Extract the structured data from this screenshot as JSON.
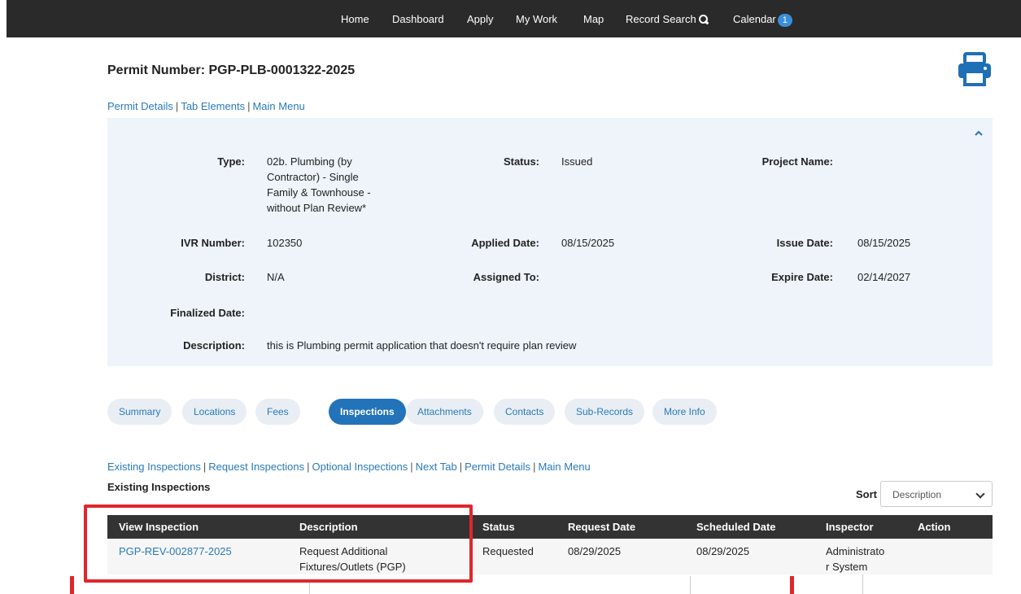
{
  "nav": {
    "items": [
      "Home",
      "Dashboard",
      "Apply",
      "My Work",
      "Map",
      "Record Search",
      "Calendar"
    ],
    "calendar_badge": "1"
  },
  "page": {
    "title": "Permit Number: PGP-PLB-0001322-2025",
    "breadcrumb": [
      "Permit Details",
      "Tab Elements",
      "Main Menu"
    ]
  },
  "details": {
    "type_label": "Type:",
    "type_value_lines": [
      "02b. Plumbing (by",
      "Contractor) - Single",
      "Family & Townhouse -",
      "without Plan Review*"
    ],
    "status_label": "Status:",
    "status_value": "Issued",
    "project_label": "Project Name:",
    "project_value": "",
    "ivr_label": "IVR Number:",
    "ivr_value": "102350",
    "applied_label": "Applied Date:",
    "applied_value": "08/15/2025",
    "issue_label": "Issue Date:",
    "issue_value": "08/15/2025",
    "district_label": "District:",
    "district_value": "N/A",
    "assigned_label": "Assigned To:",
    "assigned_value": "",
    "expire_label": "Expire Date:",
    "expire_value": "02/14/2027",
    "finalized_label": "Finalized Date:",
    "finalized_value": "",
    "description_label": "Description:",
    "description_value": "this is Plumbing permit application that doesn't require plan review"
  },
  "tabs": [
    "Summary",
    "Locations",
    "Fees",
    "Inspections",
    "Attachments",
    "Contacts",
    "Sub-Records",
    "More Info"
  ],
  "active_tab": "Inspections",
  "inspections": {
    "subnav": [
      "Existing Inspections",
      "Request Inspections",
      "Optional Inspections",
      "Next Tab",
      "Permit Details",
      "Main Menu"
    ],
    "section_title": "Existing Inspections",
    "sort_label": "Sort",
    "sort_value": "Description",
    "columns": [
      "View Inspection",
      "Description",
      "Status",
      "Request Date",
      "Scheduled Date",
      "Inspector",
      "Action"
    ],
    "rows": [
      {
        "id": "PGP-REV-002877-2025",
        "description_lines": [
          "Request Additional",
          "Fixtures/Outlets (PGP)"
        ],
        "status": "Requested",
        "request_date": "08/29/2025",
        "scheduled_date": "08/29/2025",
        "inspector_lines": [
          "Administrato",
          "r System"
        ],
        "action": ""
      }
    ]
  },
  "colors": {
    "nav_bg": "#2a2a2a",
    "link": "#2a7ab8",
    "accent": "#2273b9",
    "panel_bg": "#eef4fa",
    "highlight": "#e0262d"
  }
}
